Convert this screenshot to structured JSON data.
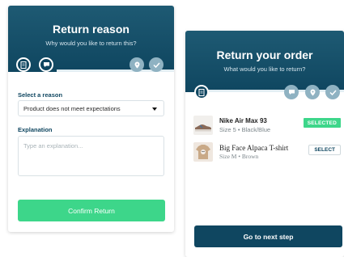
{
  "return_reason": {
    "title": "Return reason",
    "subtitle": "Why would you like to return this?",
    "steps": [
      {
        "icon": "receipt-icon",
        "state": "done"
      },
      {
        "icon": "chat-bubble-icon",
        "state": "done"
      },
      {
        "icon": "map-pin-icon",
        "state": "todo"
      },
      {
        "icon": "checkmark-icon",
        "state": "todo"
      }
    ],
    "reason_label": "Select a reason",
    "reason_value": "Product does not meet expectations",
    "explanation_label": "Explanation",
    "explanation_placeholder": "Type an explanation...",
    "confirm_label": "Confirm Return"
  },
  "return_order": {
    "title": "Return your order",
    "subtitle": "What would you like to return?",
    "steps": [
      {
        "icon": "receipt-icon",
        "state": "done"
      },
      {
        "icon": "chat-bubble-icon",
        "state": "todo"
      },
      {
        "icon": "map-pin-icon",
        "state": "todo"
      },
      {
        "icon": "checkmark-icon",
        "state": "todo"
      }
    ],
    "items": [
      {
        "name": "Nike Air Max 93",
        "meta": "Size 5 • Black/Blue",
        "action": "SELECTED",
        "selected": true,
        "thumb": "shoe-thumbnail"
      },
      {
        "name": "Big Face Alpaca T-shirt",
        "meta": "Size M • Brown",
        "action": "SELECT",
        "selected": false,
        "thumb": "tshirt-thumbnail"
      }
    ],
    "next_label": "Go to next step"
  },
  "colors": {
    "header": "#0f4660",
    "accent_green": "#3dd68a",
    "step_todo": "#8fb2c2"
  }
}
